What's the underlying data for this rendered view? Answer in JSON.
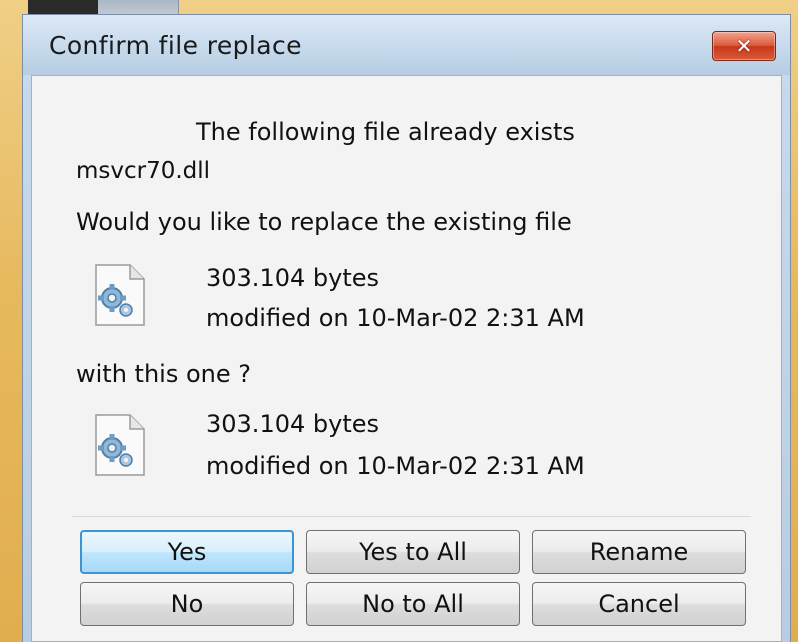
{
  "dialog": {
    "title": "Confirm file replace",
    "close_symbol": "✕",
    "heading": "The following file already exists",
    "filename": "msvcr70.dll",
    "question": "Would you like to replace the existing file",
    "existing_file": {
      "size": "303.104 bytes",
      "modified": "modified on 10-Mar-02 2:31 AM",
      "icon": "settings-file-icon"
    },
    "with_label": "with this one ?",
    "new_file": {
      "size": "303.104 bytes",
      "modified": "modified on 10-Mar-02 2:31 AM",
      "icon": "settings-file-icon"
    }
  },
  "buttons": {
    "yes": "Yes",
    "yes_to_all": "Yes to All",
    "rename": "Rename",
    "no": "No",
    "no_to_all": "No to All",
    "cancel": "Cancel"
  },
  "colors": {
    "desktop": "#e7b95e",
    "titlebar": "#c6d9ec",
    "close_button": "#d24a2a",
    "default_button_border": "#3c94d1"
  }
}
